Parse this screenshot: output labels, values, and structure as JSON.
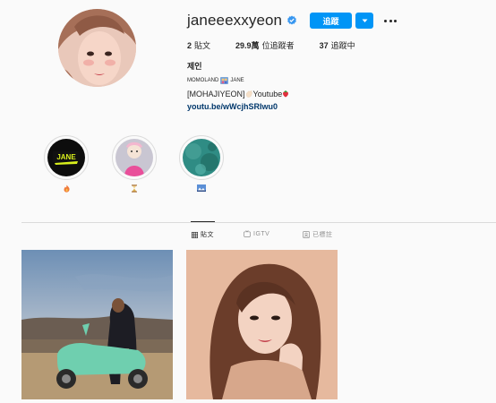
{
  "profile": {
    "username": "janeeexxyeon",
    "verified": true,
    "follow_label": "追蹤",
    "stats": [
      {
        "count": "2",
        "label": "貼文"
      },
      {
        "count": "29.9萬",
        "label": "位追蹤者"
      },
      {
        "count": "37",
        "label": "追蹤中"
      }
    ],
    "fullname": "제인",
    "bio_line1_a": "MOMOLAND",
    "bio_line1_b": "JANE",
    "bio_line2_a": "[MOHAJIYEON]",
    "bio_line2_b": "Youtube",
    "link": "youtu.be/wWcjhSRIwu0"
  },
  "highlights": [
    {
      "icon": "fire-icon",
      "story_text": "JANE"
    },
    {
      "icon": "hourglass-icon"
    },
    {
      "icon": "landscape-icon"
    }
  ],
  "tabs": [
    {
      "label": "貼文",
      "icon": "grid-icon",
      "active": true
    },
    {
      "label": "IGTV",
      "icon": "igtv-icon",
      "active": false
    },
    {
      "label": "已標註",
      "icon": "tagged-icon",
      "active": false
    }
  ],
  "colors": {
    "accent": "#0095f6",
    "link": "#00376b",
    "text": "#262626",
    "muted": "#8e8e8e",
    "background": "#fafafa"
  }
}
